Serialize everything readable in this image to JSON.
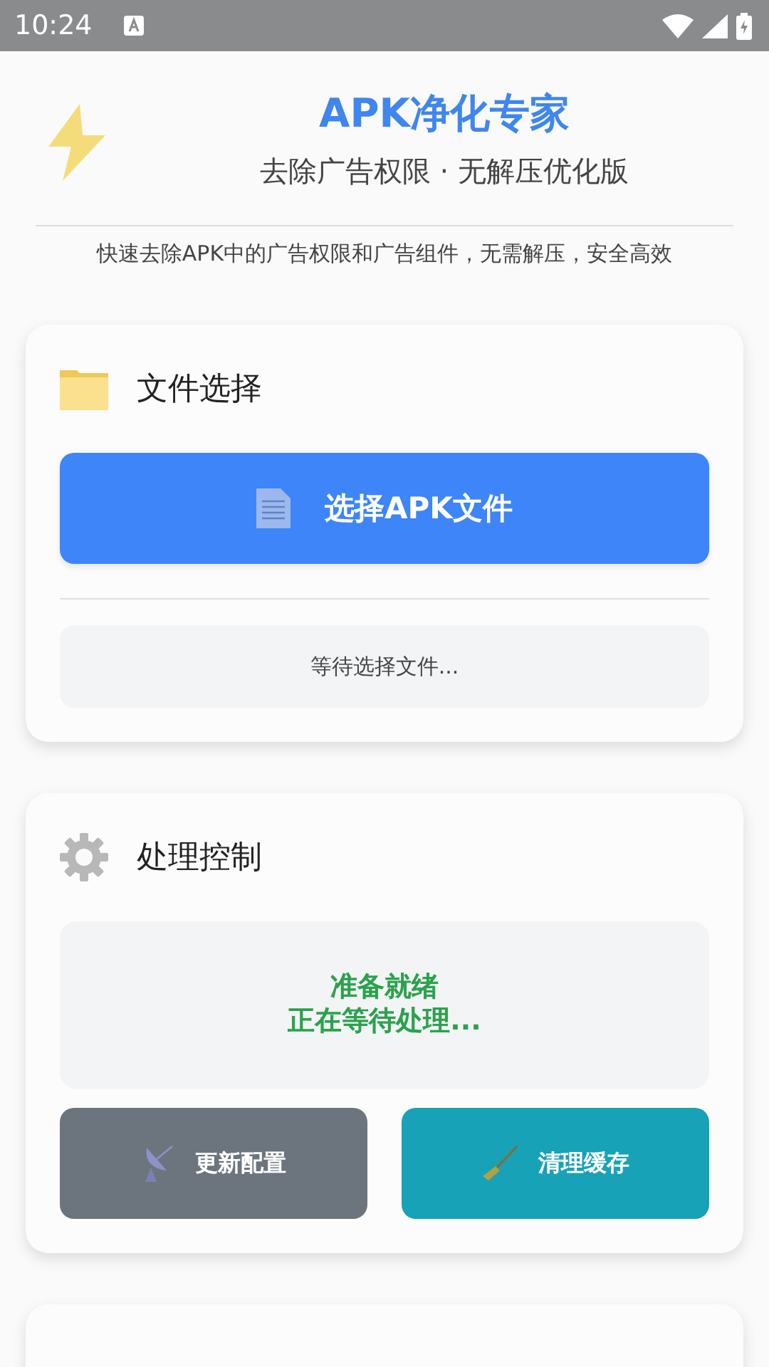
{
  "status_bar": {
    "time": "10:24"
  },
  "header": {
    "title": "APK净化专家",
    "subtitle": "去除广告权限 · 无解压优化版",
    "description": "快速去除APK中的广告权限和广告组件，无需解压，安全高效"
  },
  "file_card": {
    "title": "文件选择",
    "button": "选择APK文件",
    "file_status": "等待选择文件..."
  },
  "control_card": {
    "title": "处理控制",
    "status_lines": [
      "准备就绪",
      "正在等待处理..."
    ],
    "buttons": [
      {
        "kind": "update",
        "label": "更新配置"
      },
      {
        "kind": "clean",
        "label": "清理缓存"
      }
    ]
  }
}
